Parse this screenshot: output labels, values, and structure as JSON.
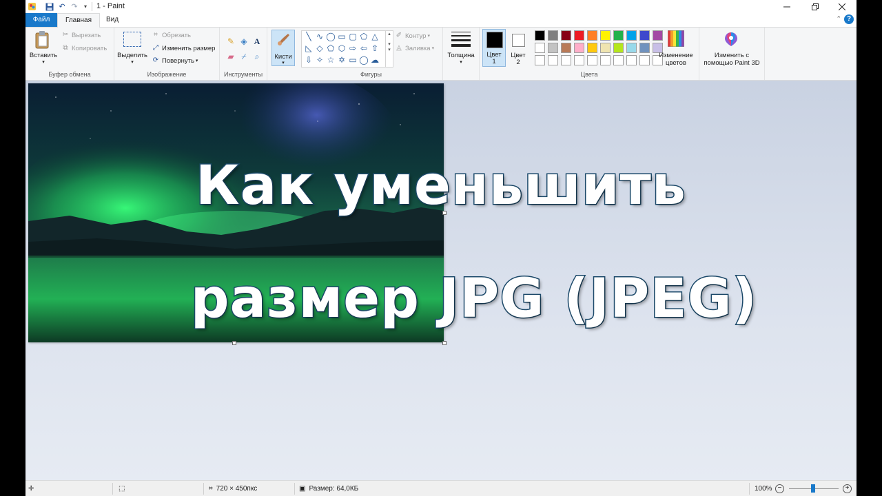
{
  "window": {
    "title": "1 - Paint"
  },
  "tabs": {
    "file": "Файл",
    "home": "Главная",
    "view": "Вид"
  },
  "clipboard": {
    "paste": "Вставить",
    "cut": "Вырезать",
    "copy": "Копировать",
    "group": "Буфер обмена"
  },
  "image": {
    "select": "Выделить",
    "crop": "Обрезать",
    "resize": "Изменить размер",
    "rotate": "Повернуть",
    "group": "Изображение"
  },
  "tools": {
    "group": "Инструменты"
  },
  "brushes": {
    "label": "Кисти"
  },
  "shapes": {
    "outline": "Контур",
    "fill": "Заливка",
    "group": "Фигуры"
  },
  "size": {
    "label": "Толщина"
  },
  "colors": {
    "color1": "Цвет",
    "color1_num": "1",
    "color2": "Цвет",
    "color2_num": "2",
    "edit_line1": "Изменение",
    "edit_line2": "цветов",
    "group": "Цвета",
    "color1_value": "#000000",
    "color2_value": "#ffffff",
    "row1": [
      "#000000",
      "#7f7f7f",
      "#880015",
      "#ed1c24",
      "#ff7f27",
      "#fff200",
      "#22b14c",
      "#00a2e8",
      "#3f48cc",
      "#a349a4"
    ],
    "row2": [
      "#ffffff",
      "#c3c3c3",
      "#b97a57",
      "#ffaec9",
      "#ffc90e",
      "#efe4b0",
      "#b5e61d",
      "#99d9ea",
      "#7092be",
      "#c8bfe7"
    ],
    "row3": [
      "#ffffff",
      "#ffffff",
      "#ffffff",
      "#ffffff",
      "#ffffff",
      "#ffffff",
      "#ffffff",
      "#ffffff",
      "#ffffff",
      "#ffffff"
    ]
  },
  "paint3d": {
    "line1": "Изменить с",
    "line2": "помощью Paint 3D"
  },
  "overlay": {
    "line1": "Как уменьшить",
    "line2": "размер JPG (JPEG)"
  },
  "status": {
    "dimensions": "720 × 450пкс",
    "size": "Размер: 64,0КБ",
    "zoom": "100%"
  }
}
